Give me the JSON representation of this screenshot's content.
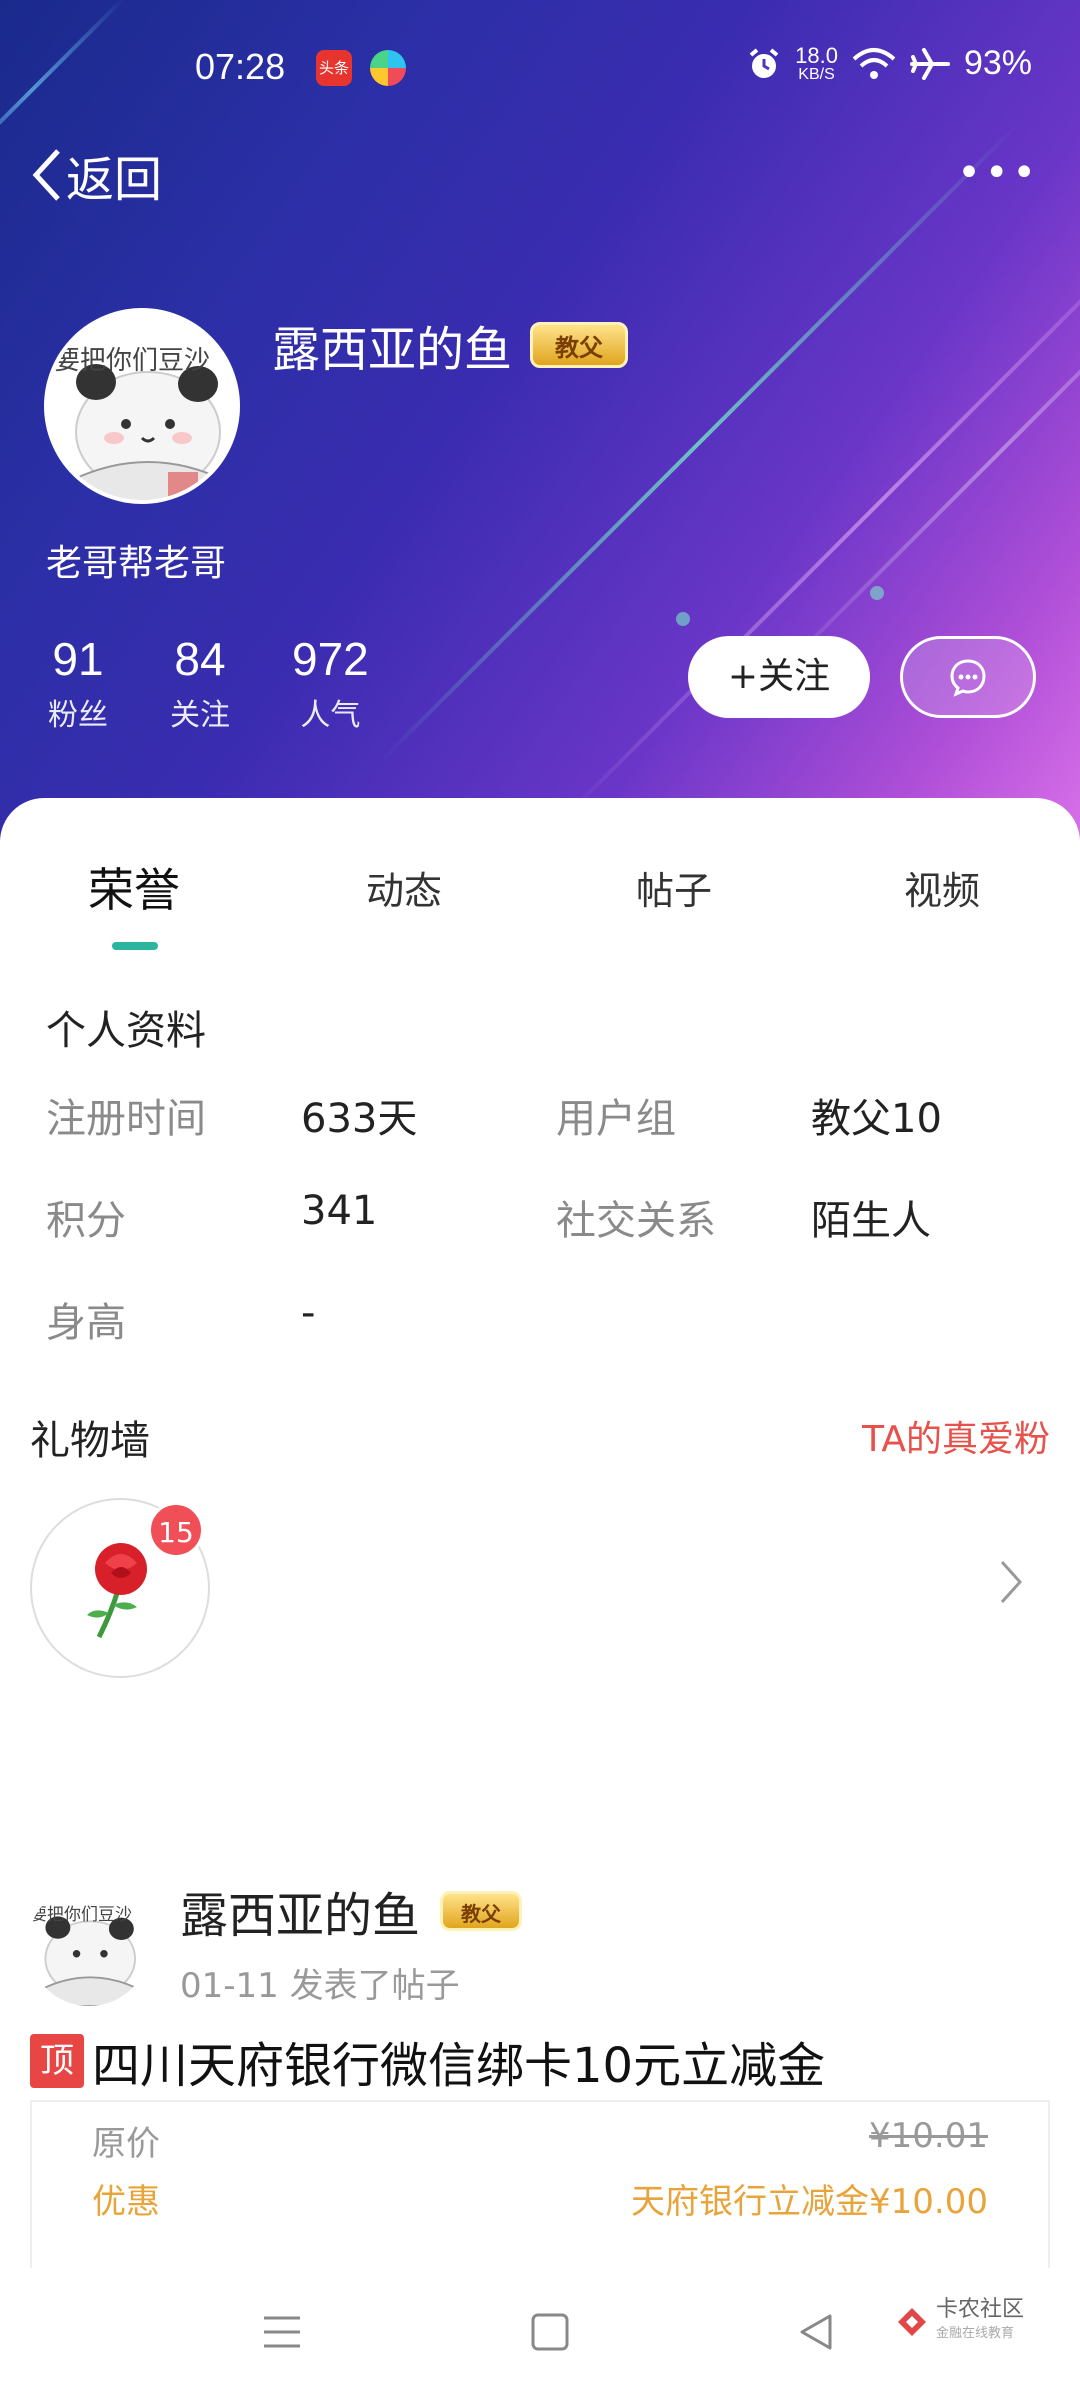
{
  "status_bar": {
    "time": "07:28",
    "app1_label": "头条",
    "speed_value": "18.0",
    "speed_unit": "KB/S",
    "battery": "93%"
  },
  "header": {
    "back_label": "返回",
    "more_label": "•••"
  },
  "profile": {
    "name": "露西亚的鱼",
    "badge": "教父",
    "signature": "老哥帮老哥",
    "avatar_text": "要把你们豆沙",
    "stats": [
      {
        "value": "91",
        "label": "粉丝"
      },
      {
        "value": "84",
        "label": "关注"
      },
      {
        "value": "972",
        "label": "人气"
      }
    ],
    "follow_label": "+关注"
  },
  "tabs": [
    "荣誉",
    "动态",
    "帖子",
    "视频"
  ],
  "personal_info": {
    "title": "个人资料",
    "rows": [
      {
        "k1": "注册时间",
        "v1": "633天",
        "k2": "用户组",
        "v2": "教父10"
      },
      {
        "k1": "积分",
        "v1": "341",
        "k2": "社交关系",
        "v2": "陌生人"
      },
      {
        "k1": "身高",
        "v1": "-",
        "k2": "",
        "v2": ""
      }
    ]
  },
  "gift_wall": {
    "title": "礼物墙",
    "link": "TA的真爱粉",
    "count": "15"
  },
  "post": {
    "author": "露西亚的鱼",
    "badge": "教父",
    "meta": "01-11  发表了帖子",
    "pin": "顶",
    "title": "四川天府银行微信绑卡10元立减金",
    "original_label": "原价",
    "original_price": "¥10.01",
    "discount_label": "优惠",
    "discount_value": "天府银行立减金¥10.00"
  },
  "watermark": {
    "title": "卡农社区",
    "subtitle": "金融在线教育"
  },
  "colors": {
    "accent": "#2bb59e",
    "discount": "#e8a43a",
    "link": "#e8504a",
    "badge_gold": "#e0a51e"
  }
}
